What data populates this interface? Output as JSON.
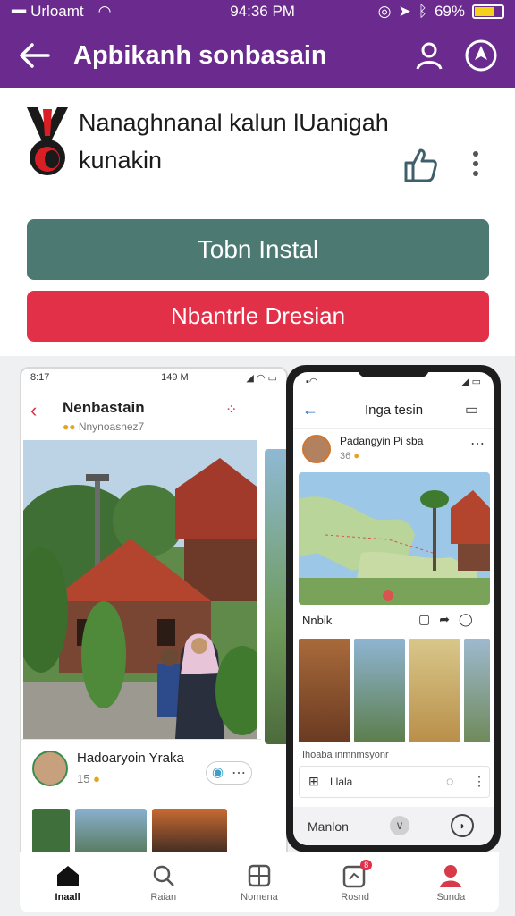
{
  "status": {
    "carrier": "Urloamt",
    "time": "94:36 PM",
    "battery": "69%",
    "battery_level": 0.69
  },
  "appbar": {
    "title": "Apbikanh sonbasain"
  },
  "app": {
    "name": "Nanaghnanal kalun lUanigah kunakin"
  },
  "buttons": {
    "install": "Tobn Instal",
    "secondary": "Nbantrle Dresian"
  },
  "screenshot1": {
    "status_time": "8:17",
    "status_mid": "149 M",
    "title": "Nenbastain",
    "subtitle": "Nnynoasnez7",
    "user_name": "Hadoaryoin Yraka",
    "user_count": "15"
  },
  "screenshot2": {
    "title": "Inga tesin",
    "post_name": "Padangyin Pi sba",
    "post_count": "36",
    "section_label": "Nnbik",
    "caption": "Ihoaba inmnmsyonr",
    "bar_label": "Llala",
    "footer_label": "Manlon"
  },
  "bottom_nav": {
    "items": [
      {
        "label": "Inaall",
        "icon": "home-icon",
        "active": true
      },
      {
        "label": "Raian",
        "icon": "search-icon",
        "active": false
      },
      {
        "label": "Nomena",
        "icon": "grid-icon",
        "active": false
      },
      {
        "label": "Rosnd",
        "icon": "badge-icon",
        "badge": "8",
        "active": false
      },
      {
        "label": "Sunda",
        "icon": "profile-icon",
        "active": false
      }
    ]
  },
  "colors": {
    "brand": "#6a2a8e",
    "install": "#4c7a72",
    "secondary": "#e33049"
  }
}
